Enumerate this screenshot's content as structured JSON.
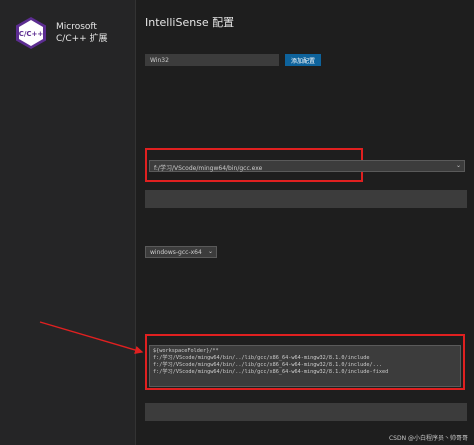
{
  "sidebar": {
    "logo_text": "C/C++",
    "title_line1": "Microsoft",
    "title_line2": "C/C++ 扩展",
    "blocks": [
      {
        "text": "",
        "link": ""
      },
      {
        "text": "",
        "link": ""
      },
      {
        "text": "",
        "link": ""
      }
    ]
  },
  "main": {
    "title": "IntelliSense 配置",
    "intro": "",
    "config_name": {
      "label": "",
      "desc": "",
      "sub_label": "",
      "value": "Win32",
      "add_button": "添加配置"
    },
    "compiler_path": {
      "label": "",
      "desc": "",
      "note": "",
      "value": "f:/学习/VScode/mingw64/bin/gcc.exe"
    },
    "compiler_args": {
      "label": "",
      "desc": "",
      "placeholder": ""
    },
    "intellisense_mode": {
      "label": "",
      "desc": "",
      "value": "windows-gcc-x64"
    },
    "include_path": {
      "label": "",
      "desc": "",
      "hint": "",
      "lines": [
        "${workspaceFolder}/**",
        "f:/学习/VScode/mingw64/bin/../lib/gcc/x86_64-w64-mingw32/8.1.0/include",
        "f:/学习/VScode/mingw64/bin/../lib/gcc/x86_64-w64-mingw32/8.1.0/include/...",
        "f:/学习/VScode/mingw64/bin/../lib/gcc/x86_64-w64-mingw32/8.1.0/include-fixed"
      ]
    },
    "defines": {
      "label": "",
      "desc": "",
      "placeholder": ""
    }
  },
  "annotation": {
    "text": "",
    "color": "#ff3b30"
  },
  "watermark": "CSDN @小白程序员丶帅哥哥",
  "colors": {
    "accent": "#0e639c",
    "highlight_box": "#e02020",
    "link": "#3794ff"
  }
}
